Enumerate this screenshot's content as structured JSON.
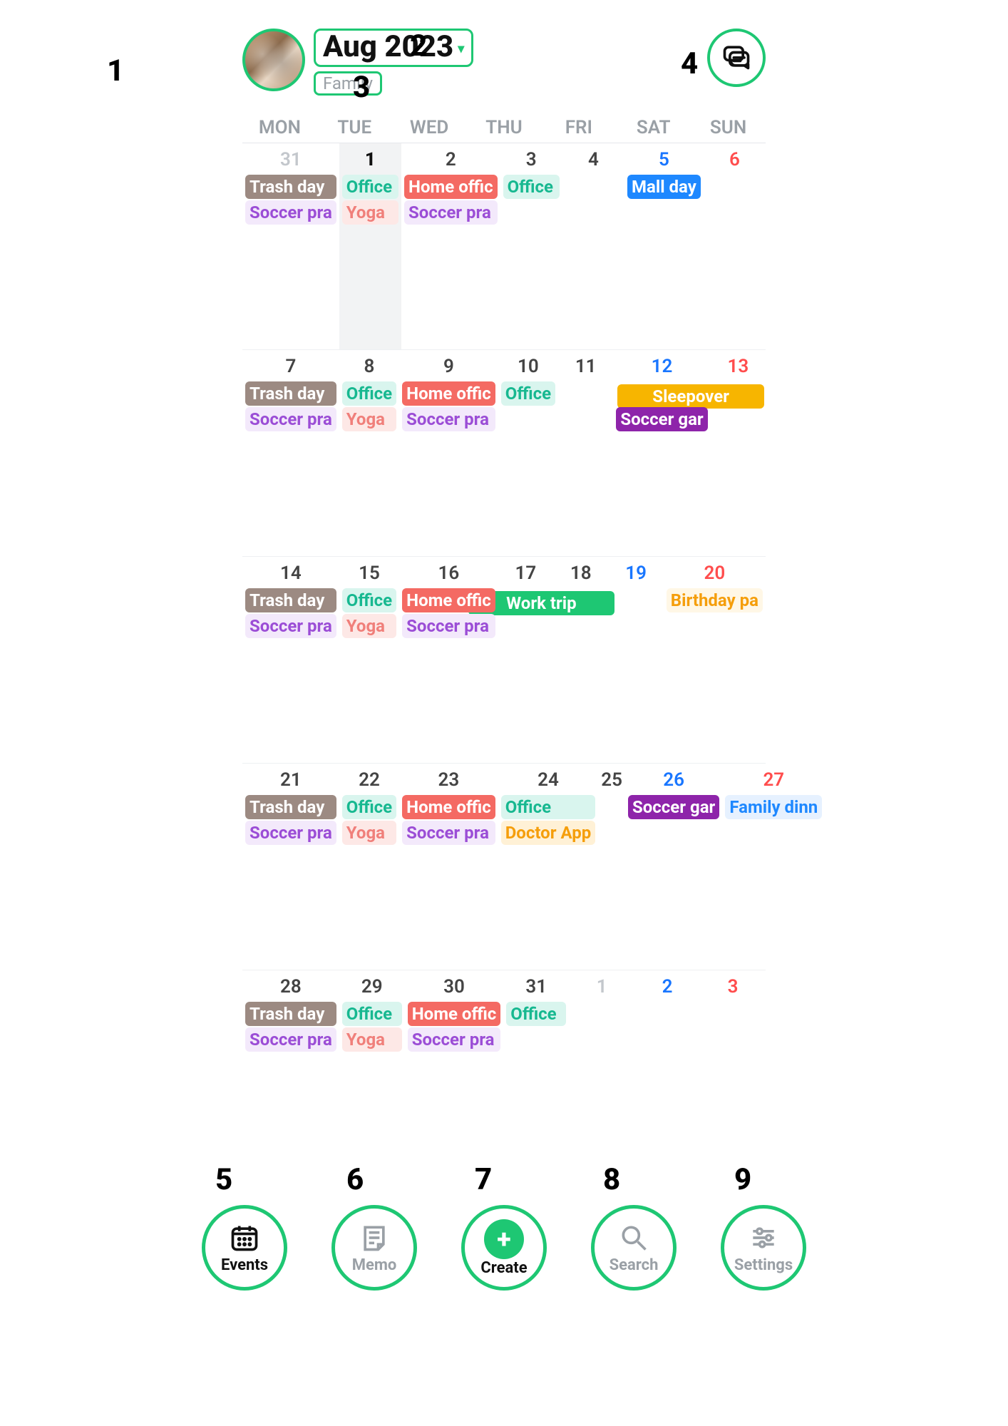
{
  "annotations": {
    "n1": "1",
    "n2": "2",
    "n3": "3",
    "n4": "4",
    "n5": "5",
    "n6": "6",
    "n7": "7",
    "n8": "8",
    "n9": "9"
  },
  "header": {
    "month_label": "Aug 2023",
    "calendar_name": "Family"
  },
  "dow": [
    "MON",
    "TUE",
    "WED",
    "THU",
    "FRI",
    "SAT",
    "SUN"
  ],
  "weeks": [
    {
      "days": [
        {
          "date": "31",
          "cls": "other",
          "today": false,
          "events": [
            {
              "label": "Trash day",
              "theme": "brown-solid"
            },
            {
              "label": "Soccer pra",
              "theme": "purple-light"
            }
          ]
        },
        {
          "date": "1",
          "cls": "today",
          "today": true,
          "events": [
            {
              "label": "Office",
              "theme": "teal-light"
            },
            {
              "label": "Yoga",
              "theme": "pink-light"
            }
          ]
        },
        {
          "date": "2",
          "cls": "",
          "today": false,
          "events": [
            {
              "label": "Home offic",
              "theme": "red-solid"
            },
            {
              "label": "Soccer pra",
              "theme": "purple-light"
            }
          ]
        },
        {
          "date": "3",
          "cls": "",
          "today": false,
          "events": [
            {
              "label": "Office",
              "theme": "teal-light"
            }
          ]
        },
        {
          "date": "4",
          "cls": "",
          "today": false,
          "events": []
        },
        {
          "date": "5",
          "cls": "sat",
          "today": false,
          "events": [
            {
              "label": "Mall day",
              "theme": "blue-solid"
            }
          ]
        },
        {
          "date": "6",
          "cls": "sun",
          "today": false,
          "events": []
        }
      ]
    },
    {
      "spans": [
        {
          "label": "Sleepover",
          "type": "sleep",
          "row": 0
        }
      ],
      "days": [
        {
          "date": "7",
          "cls": "",
          "today": false,
          "events": [
            {
              "label": "Trash day",
              "theme": "brown-solid"
            },
            {
              "label": "Soccer pra",
              "theme": "purple-light"
            }
          ]
        },
        {
          "date": "8",
          "cls": "",
          "today": false,
          "events": [
            {
              "label": "Office",
              "theme": "teal-light"
            },
            {
              "label": "Yoga",
              "theme": "pink-light"
            }
          ]
        },
        {
          "date": "9",
          "cls": "",
          "today": false,
          "events": [
            {
              "label": "Home offic",
              "theme": "red-solid"
            },
            {
              "label": "Soccer pra",
              "theme": "purple-light"
            }
          ]
        },
        {
          "date": "10",
          "cls": "",
          "today": false,
          "events": [
            {
              "label": "Office",
              "theme": "teal-light"
            }
          ]
        },
        {
          "date": "11",
          "cls": "",
          "today": false,
          "events": []
        },
        {
          "date": "12",
          "cls": "sat",
          "today": false,
          "events": [
            {
              "label": "",
              "theme": "placeholder"
            },
            {
              "label": "Soccer gar",
              "theme": "purple-solid"
            }
          ]
        },
        {
          "date": "13",
          "cls": "sun",
          "today": false,
          "events": []
        }
      ]
    },
    {
      "spans": [
        {
          "label": "Work trip",
          "type": "worktrip",
          "row": 0
        }
      ],
      "days": [
        {
          "date": "14",
          "cls": "",
          "today": false,
          "events": [
            {
              "label": "Trash day",
              "theme": "brown-solid"
            },
            {
              "label": "Soccer pra",
              "theme": "purple-light"
            }
          ]
        },
        {
          "date": "15",
          "cls": "",
          "today": false,
          "events": [
            {
              "label": "Office",
              "theme": "teal-light"
            },
            {
              "label": "Yoga",
              "theme": "pink-light"
            }
          ]
        },
        {
          "date": "16",
          "cls": "",
          "today": false,
          "events": [
            {
              "label": "Home offic",
              "theme": "red-solid"
            },
            {
              "label": "Soccer pra",
              "theme": "purple-light"
            }
          ]
        },
        {
          "date": "17",
          "cls": "",
          "today": false,
          "events": []
        },
        {
          "date": "18",
          "cls": "",
          "today": false,
          "events": []
        },
        {
          "date": "19",
          "cls": "sat",
          "today": false,
          "events": []
        },
        {
          "date": "20",
          "cls": "sun",
          "today": false,
          "events": [
            {
              "label": "Birthday pa",
              "theme": "amber-light"
            }
          ]
        }
      ]
    },
    {
      "days": [
        {
          "date": "21",
          "cls": "",
          "today": false,
          "events": [
            {
              "label": "Trash day",
              "theme": "brown-solid"
            },
            {
              "label": "Soccer pra",
              "theme": "purple-light"
            }
          ]
        },
        {
          "date": "22",
          "cls": "",
          "today": false,
          "events": [
            {
              "label": "Office",
              "theme": "teal-light"
            },
            {
              "label": "Yoga",
              "theme": "pink-light"
            }
          ]
        },
        {
          "date": "23",
          "cls": "",
          "today": false,
          "events": [
            {
              "label": "Home offic",
              "theme": "red-solid"
            },
            {
              "label": "Soccer pra",
              "theme": "purple-light"
            }
          ]
        },
        {
          "date": "24",
          "cls": "",
          "today": false,
          "events": [
            {
              "label": "Office",
              "theme": "teal-light"
            },
            {
              "label": "Doctor App",
              "theme": "orange-light"
            }
          ]
        },
        {
          "date": "25",
          "cls": "",
          "today": false,
          "events": []
        },
        {
          "date": "26",
          "cls": "sat",
          "today": false,
          "events": [
            {
              "label": "Soccer gar",
              "theme": "purple-solid"
            }
          ]
        },
        {
          "date": "27",
          "cls": "sun",
          "today": false,
          "events": [
            {
              "label": "Family dinn",
              "theme": "blue-light"
            }
          ]
        }
      ]
    },
    {
      "days": [
        {
          "date": "28",
          "cls": "",
          "today": false,
          "events": [
            {
              "label": "Trash day",
              "theme": "brown-solid"
            },
            {
              "label": "Soccer pra",
              "theme": "purple-light"
            }
          ]
        },
        {
          "date": "29",
          "cls": "",
          "today": false,
          "events": [
            {
              "label": "Office",
              "theme": "teal-light"
            },
            {
              "label": "Yoga",
              "theme": "pink-light"
            }
          ]
        },
        {
          "date": "30",
          "cls": "",
          "today": false,
          "events": [
            {
              "label": "Home offic",
              "theme": "red-solid"
            },
            {
              "label": "Soccer pra",
              "theme": "purple-light"
            }
          ]
        },
        {
          "date": "31",
          "cls": "",
          "today": false,
          "events": [
            {
              "label": "Office",
              "theme": "teal-light"
            }
          ]
        },
        {
          "date": "1",
          "cls": "other",
          "today": false,
          "events": []
        },
        {
          "date": "2",
          "cls": "other sat",
          "today": false,
          "events": []
        },
        {
          "date": "3",
          "cls": "other sun",
          "today": false,
          "events": []
        }
      ]
    }
  ],
  "nav": {
    "events": "Events",
    "memo": "Memo",
    "create": "Create",
    "search": "Search",
    "settings": "Settings"
  }
}
